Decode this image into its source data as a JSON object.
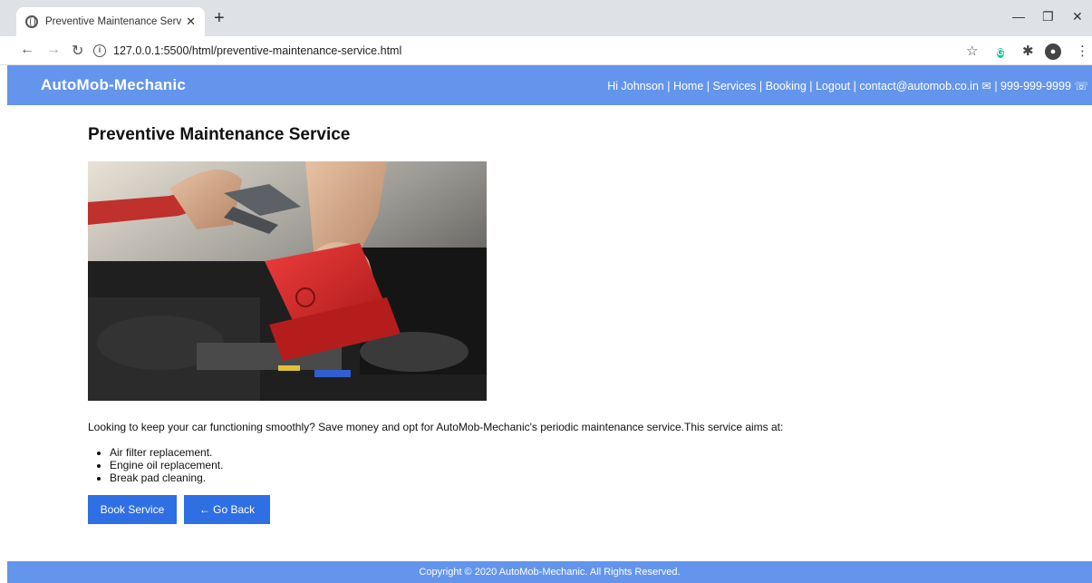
{
  "browser": {
    "tab_title": "Preventive Maintenance Service |",
    "url": "127.0.0.1:5500/html/preventive-maintenance-service.html",
    "icons": [
      "back-icon",
      "forward-icon",
      "reload-icon",
      "info-icon",
      "star-icon",
      "grammarly-icon",
      "extensions-icon",
      "profile-icon",
      "menu-icon"
    ]
  },
  "header": {
    "logo": "AutoMob-Mechanic",
    "nav": "Hi Johnson | Home | Services | Booking | Logout | contact@automob.co.in ✉ | 999-999-9999 ☏"
  },
  "main": {
    "title": "Preventive Maintenance Service",
    "intro": "Looking to keep your car functioning smoothly? Save money and opt for AutoMob-Mechanic's periodic maintenance service.This service aims at:",
    "features": [
      "Air filter replacement.",
      "Engine oil replacement.",
      "Break pad cleaning."
    ],
    "book_button": "Book Service",
    "back_button": "← Go Back"
  },
  "footer": {
    "copyright": "Copyright © 2020 AutoMob-Mechanic.  All Rights Reserved."
  },
  "colors": {
    "header_bg": "#6495ed",
    "button_bg": "#2f6fe4",
    "tabbar_bg": "#dee1e6"
  }
}
